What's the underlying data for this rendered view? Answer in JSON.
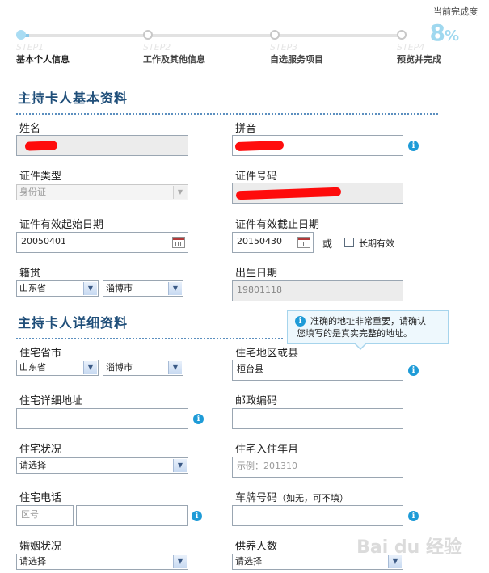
{
  "progress": {
    "label": "当前完成度",
    "value": "8",
    "unit": "%"
  },
  "steps": [
    {
      "ghost": "STEP1",
      "name": "基本个人信息"
    },
    {
      "ghost": "STEP2",
      "name": "工作及其他信息"
    },
    {
      "ghost": "STEP3",
      "name": "自选服务项目"
    },
    {
      "ghost": "STEP4",
      "name": "预览并完成"
    }
  ],
  "basic": {
    "title": "主持卡人基本资料",
    "name_label": "姓名",
    "pinyin_label": "拼音",
    "id_type_label": "证件类型",
    "id_type_value": "身份证",
    "id_number_label": "证件号码",
    "id_start_label": "证件有效起始日期",
    "id_start_value": "20050401",
    "id_end_label": "证件有效截止日期",
    "id_end_value": "20150430",
    "or_text": "或",
    "long_term_label": "长期有效",
    "native_label": "籍贯",
    "native_province": "山东省",
    "native_city": "淄博市",
    "birth_label": "出生日期",
    "birth_value": "19801118"
  },
  "detail": {
    "title": "主持卡人详细资料",
    "tooltip_line1": "准确的地址非常重要，请确认",
    "tooltip_line2": "您填写的是真实完整的地址。",
    "home_province_label": "住宅省市",
    "home_province": "山东省",
    "home_city": "淄博市",
    "home_district_label": "住宅地区或县",
    "home_district_value": "桓台县",
    "home_address_label": "住宅详细地址",
    "postcode_label": "邮政编码",
    "home_status_label": "住宅状况",
    "home_status_value": "请选择",
    "move_in_label": "住宅入住年月",
    "move_in_placeholder": "示例：201310",
    "phone_label": "住宅电话",
    "area_code_placeholder": "区号",
    "plate_label": "车牌号码",
    "plate_hint": "（如无，可不填）",
    "marital_label": "婚姻状况",
    "marital_value": "请选择",
    "dependents_label": "供养人数",
    "dependents_value": "请选择"
  },
  "watermark": "Bai du 经验",
  "colors": {
    "title": "#1f4e79",
    "progress": "#9fd8ef",
    "info_icon": "#1e9bd7",
    "redaction": "#ff0000"
  }
}
